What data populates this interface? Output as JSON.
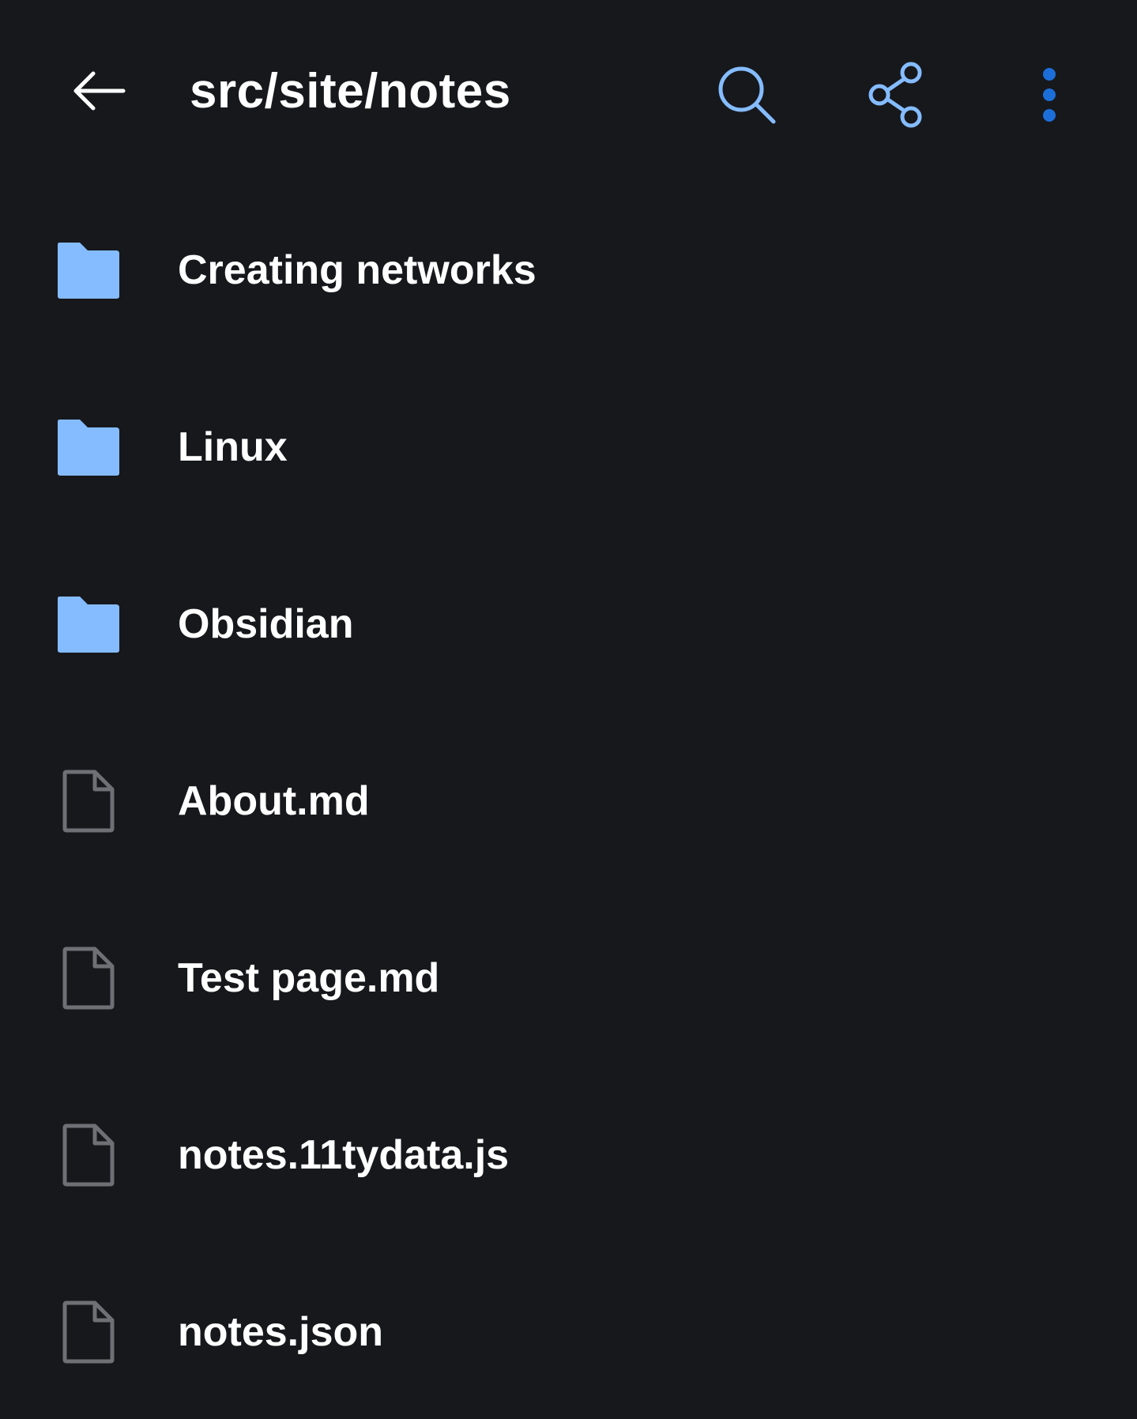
{
  "header": {
    "back_icon": "arrow-left-icon",
    "path": "src/site/notes",
    "search_icon": "search-icon",
    "share_icon": "share-icon",
    "more_icon": "more-vertical-icon"
  },
  "colors": {
    "background": "#17181c",
    "folder": "#85bcff",
    "file_outline": "#6f7076",
    "accent_light": "#85bcff",
    "accent_dark": "#1c6fd9",
    "text": "#ffffff"
  },
  "items": [
    {
      "type": "folder",
      "icon": "folder-icon",
      "name": "Creating networks"
    },
    {
      "type": "folder",
      "icon": "folder-icon",
      "name": "Linux"
    },
    {
      "type": "folder",
      "icon": "folder-icon",
      "name": "Obsidian"
    },
    {
      "type": "file",
      "icon": "file-icon",
      "name": "About.md"
    },
    {
      "type": "file",
      "icon": "file-icon",
      "name": "Test page.md"
    },
    {
      "type": "file",
      "icon": "file-icon",
      "name": "notes.11tydata.js"
    },
    {
      "type": "file",
      "icon": "file-icon",
      "name": "notes.json"
    }
  ]
}
